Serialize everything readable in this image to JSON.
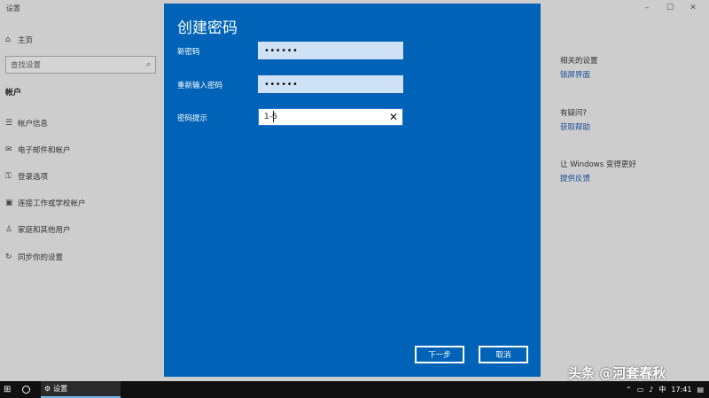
{
  "window": {
    "title": "设置",
    "controls": {
      "minimize": "–",
      "maximize": "☐",
      "close": "✕"
    }
  },
  "sidebar": {
    "home": "主页",
    "search_placeholder": "查找设置",
    "section": "帐户",
    "items": [
      {
        "label": "帐户信息",
        "icon": "person-card-icon"
      },
      {
        "label": "电子邮件和帐户",
        "icon": "mail-icon"
      },
      {
        "label": "登录选项",
        "icon": "key-icon"
      },
      {
        "label": "连接工作或学校帐户",
        "icon": "briefcase-icon"
      },
      {
        "label": "家庭和其他用户",
        "icon": "people-icon"
      },
      {
        "label": "同步你的设置",
        "icon": "sync-icon"
      }
    ]
  },
  "right_panel": {
    "related_heading": "相关的设置",
    "related_link": "锁屏界面",
    "question_heading": "有疑问?",
    "question_link": "获取帮助",
    "improve_heading": "让 Windows 变得更好",
    "improve_link": "提供反馈"
  },
  "dialog": {
    "title": "创建密码",
    "new_password_label": "新密码",
    "new_password_value": "••••••",
    "confirm_label": "重新输入密码",
    "confirm_value": "••••••",
    "hint_label": "密码提示",
    "hint_value": "1-6",
    "next_button": "下一步",
    "cancel_button": "取消"
  },
  "taskbar": {
    "app_label": "设置",
    "ime": "中",
    "time": "17:41"
  },
  "watermark": "头条 @河套春秋"
}
